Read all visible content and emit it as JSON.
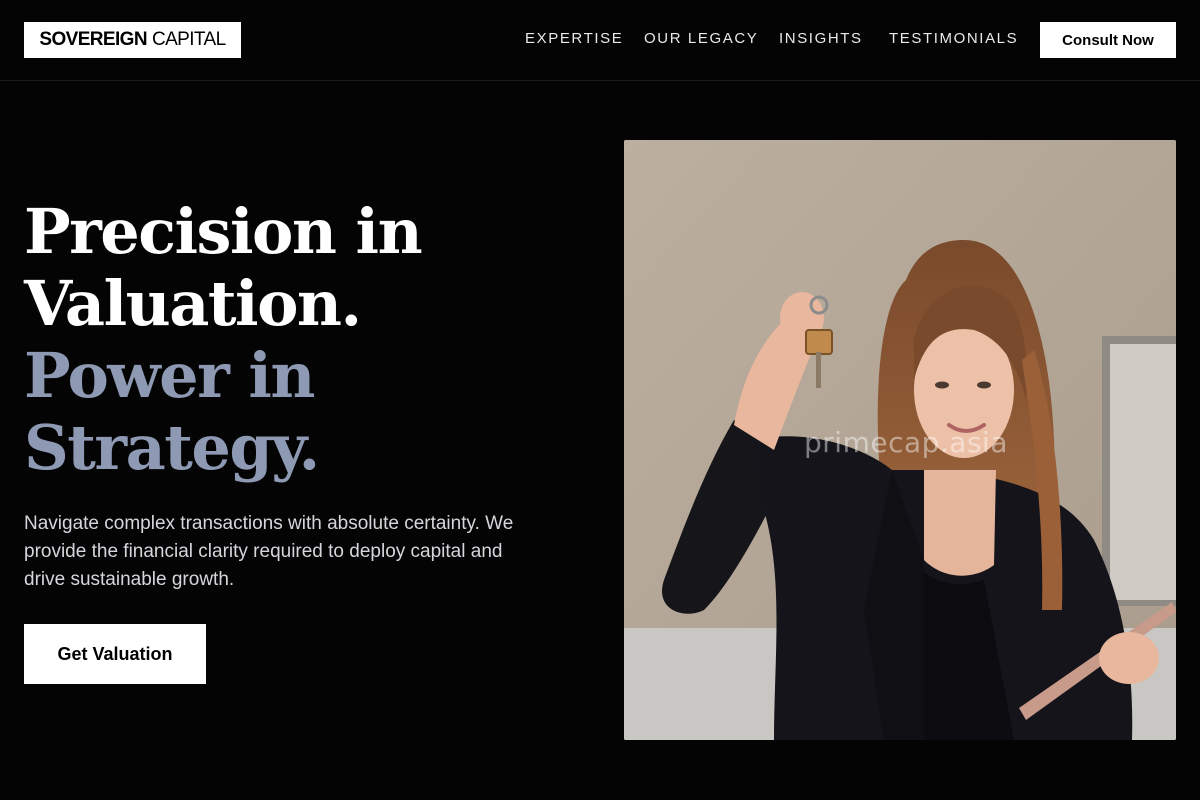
{
  "header": {
    "logo_bold": "SOVEREIGN",
    "logo_light": "CAPITAL",
    "nav": [
      {
        "label": "EXPERTISE"
      },
      {
        "label": "OUR LEGACY"
      },
      {
        "label": "INSIGHTS"
      },
      {
        "label": "TESTIMONIALS"
      }
    ],
    "cta_label": "Consult Now"
  },
  "hero": {
    "headline_line1": "Precision in",
    "headline_line2": "Valuation.",
    "headline_line3": "Power in",
    "headline_line4": "Strategy.",
    "subtext": "Navigate complex transactions with absolute certainty. We provide the financial clarity required to deploy capital and drive sustainable growth.",
    "cta_label": "Get Valuation",
    "accent_color": "#8e9ab4"
  },
  "photo": {
    "watermark": "primecap.asia"
  }
}
